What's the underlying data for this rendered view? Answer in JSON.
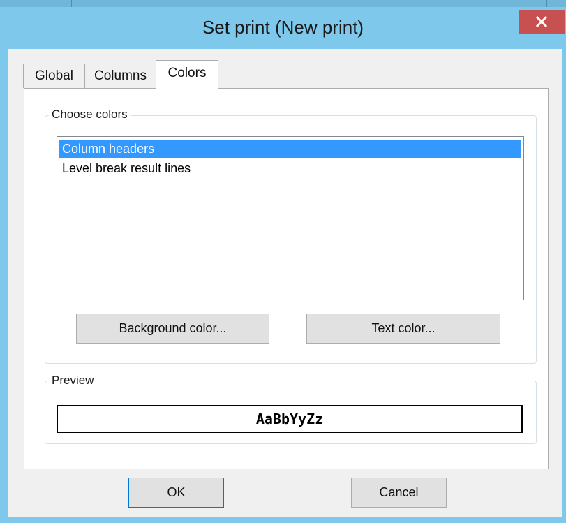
{
  "window": {
    "title": "Set print (New print)",
    "close_icon": "close-icon",
    "accent_color": "#7ec8ec",
    "close_color": "#c75050"
  },
  "tabs": [
    {
      "label": "Global",
      "active": false
    },
    {
      "label": "Columns",
      "active": false
    },
    {
      "label": "Colors",
      "active": true
    }
  ],
  "choose_colors": {
    "label": "Choose colors",
    "items": [
      {
        "label": "Column headers",
        "selected": true
      },
      {
        "label": "Level break result lines",
        "selected": false
      }
    ],
    "selection_color": "#3399ff",
    "background_button": "Background color...",
    "text_button": "Text color..."
  },
  "preview": {
    "label": "Preview",
    "sample_text": "AaBbYyZz"
  },
  "footer": {
    "ok_label": "OK",
    "cancel_label": "Cancel"
  }
}
